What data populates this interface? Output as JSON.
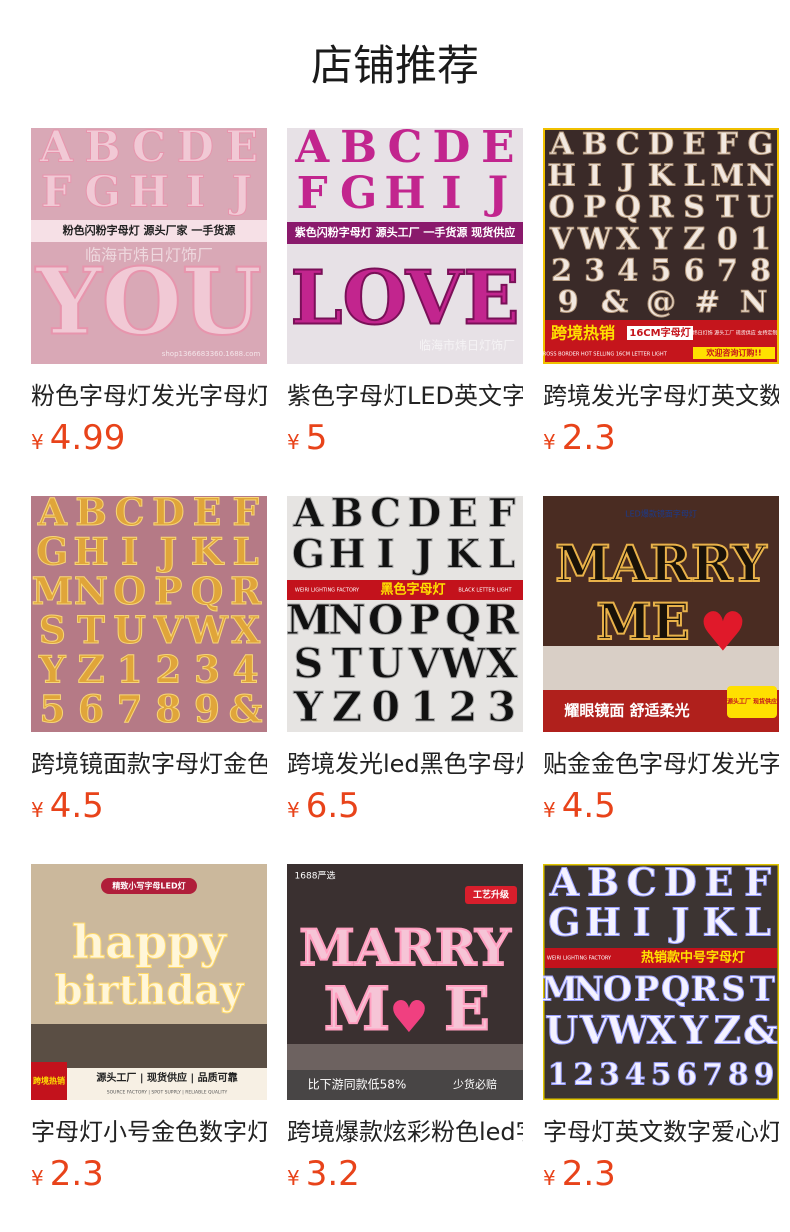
{
  "header": {
    "title": "店铺推荐"
  },
  "products": [
    {
      "name": "粉色字母灯发光字母灯",
      "currency": "¥",
      "price": "4.99",
      "bg": "#d9a8b6",
      "letter_color": "#f1c9d5",
      "banner_color": "#f6e0e6",
      "rows": [
        "ABCDE",
        "FGHIJ"
      ],
      "big": "YOU",
      "banner": "粉色闪粉字母灯   源头厂家   一手货源",
      "watermark": "临海市炜日灯饰厂",
      "shop_tag": "shop1366683360.1688.com"
    },
    {
      "name": "紫色字母灯LED英文字母灯",
      "currency": "¥",
      "price": "5",
      "bg": "#e7e1e6",
      "letter_color": "#c2258e",
      "banner_color": "#8a1a6c",
      "rows": [
        "ABCDE",
        "FGHIJ"
      ],
      "big": "LOVE",
      "banner": "紫色闪粉字母灯 源头工厂 一手货源 现货供应",
      "watermark": "临海市炜日灯饰厂"
    },
    {
      "name": "跨境发光字母灯英文数字灯",
      "currency": "¥",
      "price": "2.3",
      "bg": "#3a2a28",
      "letter_color": "#f2e8e0",
      "rows": [
        "ABCDEFG",
        "HIJKLMN",
        "OPQRSTU",
        "VWXYZ01",
        "2345678",
        "9&@#N"
      ],
      "banner": "跨境热销",
      "banner_sub": "16CM字母灯",
      "banner_small": "炜日灯饰  源头工厂  现货供应  支持定制",
      "banner_en": "CROSS BORDER HOT SELLING   16CM LETTER LIGHT",
      "banner_cta": "欢迎咨询订购!!"
    },
    {
      "name": "跨境镜面款字母灯金色",
      "currency": "¥",
      "price": "4.5",
      "bg": "#b57a86",
      "letter_color": "#e0a53a",
      "rows": [
        "ABCDEF",
        "GHIJKL",
        "MNOPQR",
        "STUVWX",
        "YZ1234",
        "56789&"
      ]
    },
    {
      "name": "跨境发光led黑色字母灯",
      "currency": "¥",
      "price": "6.5",
      "bg": "#e6e4e2",
      "letter_color": "#111111",
      "rows": [
        "ABCDEF",
        "GHIJKL",
        "MNOPQR",
        "STUVWX",
        "YZ0123"
      ],
      "banner": "黑色字母灯",
      "banner_left": "WEIRI LIGHTING FACTORY",
      "banner_right": "BLACK LETTER LIGHT"
    },
    {
      "name": "贴金金色字母灯发光字母",
      "currency": "¥",
      "price": "4.5",
      "bg": "#4a2c22",
      "letter_color": "#1a1208",
      "top_tag": "LED爆款镜面字母灯",
      "big1": "MARRY",
      "big2": "ME",
      "banner": "耀眼镜面 舒适柔光",
      "badge": "源头工厂 现货供应"
    },
    {
      "name": "字母灯小号金色数字灯",
      "currency": "¥",
      "price": "2.3",
      "bg": "#cbb89c",
      "letter_color": "#fff6d9",
      "top_tag": "精致小写字母LED灯",
      "big1": "happy",
      "big2": "birthday",
      "banner": "源头工厂 | 现货供应 | 品质可靠",
      "corner": "跨境热销",
      "banner_en": "SOURCE FACTORY | SPOT SUPPLY | RELIABLE QUALITY"
    },
    {
      "name": "跨境爆款炫彩粉色led字母灯",
      "currency": "¥",
      "price": "3.2",
      "bg": "#3a3030",
      "letter_color": "#f6c4d6",
      "top_tag": "1688严选",
      "corner": "工艺升级",
      "big1": "MARRY",
      "big2": "ME",
      "footer_left": "比下游同款低58%",
      "footer_right": "少货必赔"
    },
    {
      "name": "字母灯英文数字爱心灯",
      "currency": "¥",
      "price": "2.3",
      "bg": "#3c3432",
      "letter_color": "#f4f2ff",
      "rows": [
        "ABCDEF",
        "GHIJKL",
        "MNOPQRST",
        "UVWXYZ&",
        "123456789"
      ],
      "banner": "热销款中号字母灯",
      "banner_left": "WEIRI LIGHTING FACTORY"
    }
  ]
}
